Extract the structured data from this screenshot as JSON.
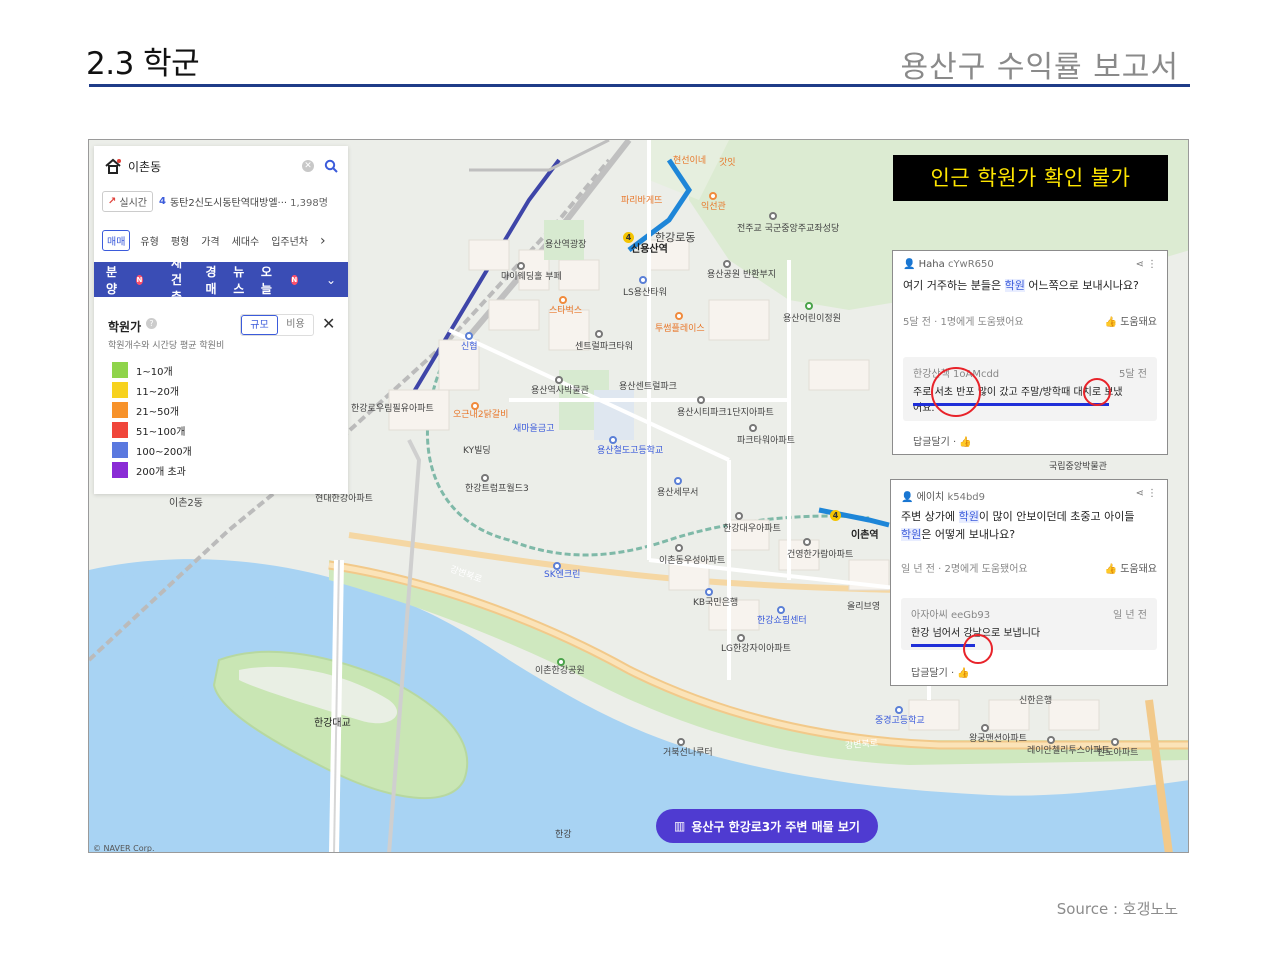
{
  "header": {
    "section_title": "2.3 학군",
    "report_title": "용산구 수익률 보고서"
  },
  "source": "Source : 호갱노노",
  "search": {
    "query": "이촌동",
    "realtime_label": "실시간",
    "realtime_rank": "4",
    "realtime_text": "동탄2신도시동탄역대방엘···",
    "realtime_count": "1,398명",
    "filters": [
      "매매",
      "유형",
      "평형",
      "가격",
      "세대수",
      "입주년차"
    ],
    "active_filter": "매매",
    "menu": [
      "분양",
      "재건축",
      "경매",
      "뉴스",
      "오늘"
    ],
    "menu_badge": "N"
  },
  "legend": {
    "title": "학원가",
    "subtitle": "학원개수와 시간당 평균 학원비",
    "toggle_on": "규모",
    "toggle_off": "비용",
    "items": [
      {
        "label": "1~10개",
        "color": "#8fd44a"
      },
      {
        "label": "11~20개",
        "color": "#f7d21e"
      },
      {
        "label": "21~50개",
        "color": "#f7922a"
      },
      {
        "label": "51~100개",
        "color": "#f0453a"
      },
      {
        "label": "100~200개",
        "color": "#5a78df"
      },
      {
        "label": "200개 초과",
        "color": "#8a2bd6"
      }
    ]
  },
  "alert": "인근 학원가 확인 불가",
  "card1": {
    "user": "Haha",
    "user_id": "cYwR650",
    "question_pre": "여기 거주하는 분들은 ",
    "question_hl": "학원",
    "question_post": " 어느쪽으로 보내시나요?",
    "meta": "5달 전 · 1명에게 도움됐어요",
    "help": "도움돼요",
    "reply_user": "한강산책",
    "reply_id": "1oAMcdd",
    "reply_time": "5달 전",
    "reply_line1": "주로 서초 반포 많이 갔고 주말/방학때 대치로 보냈",
    "reply_line2": "어요.",
    "answer": "답글달기"
  },
  "card2": {
    "user": "에이치",
    "user_id": "k54bd9",
    "q1_pre": "주변 상가에 ",
    "q1_hl": "학원",
    "q1_post": "이 많이 안보이던데 초중고 아이들",
    "q2_hl": "학원",
    "q2_post": "은 어떻게 보내나요?",
    "meta": "일 년 전 · 2명에게 도움됐어요",
    "help": "도움돼요",
    "reply_user": "아자아씨",
    "reply_id": "eeGb93",
    "reply_time": "일 년 전",
    "reply_line1": "한강 넘어서 강남으로 보냅니다",
    "answer": "답글달기"
  },
  "cta": "용산구 한강로3가 주변 매물 보기",
  "map": {
    "attribution": "© NAVER Corp.",
    "stations": [
      "신용산역",
      "이촌역"
    ],
    "labels": [
      {
        "t": "한강대교"
      },
      {
        "t": "이촌2동"
      },
      {
        "t": "강변북로"
      },
      {
        "t": "용산역사박물관"
      },
      {
        "t": "용산세무서"
      },
      {
        "t": "국립중앙박물관"
      },
      {
        "t": "센트럴파크타워"
      },
      {
        "t": "용산철도고등학교"
      },
      {
        "t": "파크타워아파트"
      },
      {
        "t": "한강대우아파트"
      },
      {
        "t": "이촌동우성아파트"
      },
      {
        "t": "건영한가람아파트"
      },
      {
        "t": "KB국민은행"
      },
      {
        "t": "한강쇼핑센터"
      },
      {
        "t": "LG한강자이아파트"
      },
      {
        "t": "이촌한강공원"
      },
      {
        "t": "거북선나루터"
      },
      {
        "t": "SK엔크린"
      },
      {
        "t": "현대한강아파트"
      },
      {
        "t": "한강트럼프월드3"
      },
      {
        "t": "KY빌딩"
      },
      {
        "t": "새마을금고"
      },
      {
        "t": "오근내2닭갈비"
      },
      {
        "t": "신협"
      },
      {
        "t": "한강로우림필유아파트"
      },
      {
        "t": "마이웨딩홀 부페"
      },
      {
        "t": "스타벅스"
      },
      {
        "t": "투썸플레이스"
      },
      {
        "t": "LS용산타워"
      },
      {
        "t": "용산공원 반환부지"
      },
      {
        "t": "용산어린이정원"
      },
      {
        "t": "전주교 국군중앙주교좌성당"
      },
      {
        "t": "익선관"
      },
      {
        "t": "현선이네"
      },
      {
        "t": "갓잇"
      },
      {
        "t": "파리바게뜨"
      },
      {
        "t": "한강로동"
      },
      {
        "t": "용산시티파크1단지아파트"
      },
      {
        "t": "용산센트럴파크"
      },
      {
        "t": "중경고등학교"
      },
      {
        "t": "왕궁맨션아파트"
      },
      {
        "t": "레이안첼리투스아파트"
      },
      {
        "t": "반도아파트"
      },
      {
        "t": "신한은행"
      },
      {
        "t": "올리브영"
      },
      {
        "t": "용산역광장"
      },
      {
        "t": "한강"
      }
    ]
  }
}
